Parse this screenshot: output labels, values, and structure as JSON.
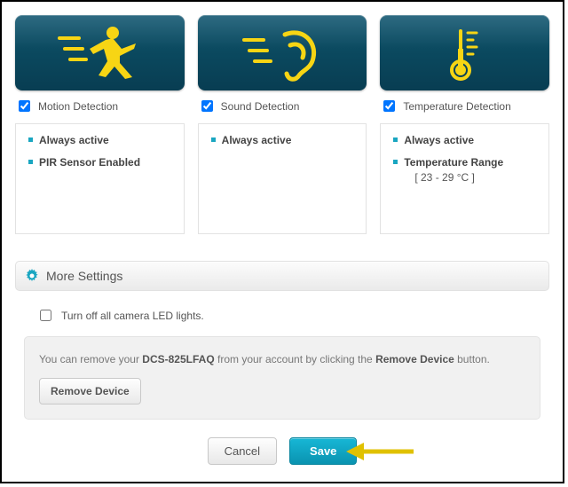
{
  "cards": {
    "motion": {
      "label": "Motion Detection",
      "checked": true,
      "items": [
        "Always active",
        "PIR Sensor Enabled"
      ]
    },
    "sound": {
      "label": "Sound Detection",
      "checked": true,
      "items": [
        "Always active"
      ]
    },
    "temperature": {
      "label": "Temperature Detection",
      "checked": true,
      "items": [
        "Always active",
        "Temperature Range"
      ],
      "range": "[ 23 - 29 °C ]"
    }
  },
  "more_settings": {
    "title": "More Settings",
    "led_label": "Turn off all camera LED lights.",
    "led_checked": false,
    "remove_pre": "You can remove your ",
    "device_name": "DCS-825LFAQ",
    "remove_mid": " from your account by clicking the ",
    "remove_bold": "Remove Device",
    "remove_post": " button.",
    "remove_btn": "Remove Device"
  },
  "footer": {
    "cancel": "Cancel",
    "save": "Save"
  },
  "colors": {
    "accent": "#1aa6c1",
    "icon_yellow": "#f7d514"
  }
}
